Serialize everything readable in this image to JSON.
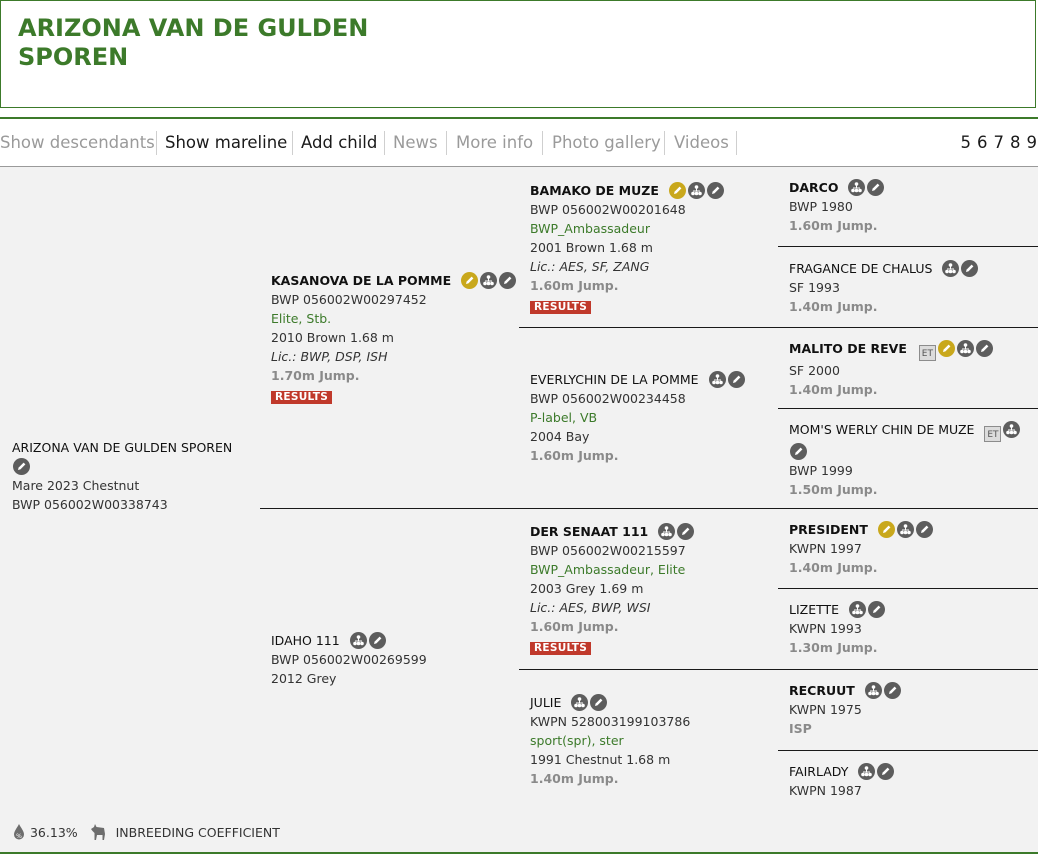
{
  "title": "ARIZONA VAN DE GULDEN SPOREN",
  "nav": {
    "items": [
      "Show descendants",
      "Show mareline",
      "Add child",
      "News",
      "More info",
      "Photo gallery",
      "Videos"
    ],
    "generations": [
      "5",
      "6",
      "7",
      "8",
      "9"
    ]
  },
  "subject": {
    "name": "ARIZONA VAN DE GULDEN SPOREN",
    "desc": "Mare 2023 Chestnut",
    "reg": "BWP 056002W00338743"
  },
  "sire": {
    "name": "KASANOVA DE LA POMME",
    "reg": "BWP 056002W00297452",
    "pred": "Elite, Stb.",
    "desc": "2010 Brown 1.68 m",
    "lic": "Lic.: BWP, DSP, ISH",
    "jump": "1.70m Jump.",
    "results": "RESULTS"
  },
  "dam": {
    "name": "IDAHO 111",
    "reg": "BWP 056002W00269599",
    "desc": "2012 Grey"
  },
  "ss": {
    "name": "BAMAKO DE MUZE",
    "reg": "BWP 056002W00201648",
    "pred": "BWP_Ambassadeur",
    "desc": "2001 Brown 1.68 m",
    "lic": "Lic.: AES, SF, ZANG",
    "jump": "1.60m Jump.",
    "results": "RESULTS"
  },
  "sd": {
    "name": "EVERLYCHIN DE LA POMME",
    "reg": "BWP 056002W00234458",
    "pred": "P-label, VB",
    "desc": "2004 Bay",
    "jump": "1.60m Jump."
  },
  "ds": {
    "name": "DER SENAAT 111",
    "reg": "BWP 056002W00215597",
    "pred": "BWP_Ambassadeur, Elite",
    "desc": "2003 Grey 1.69 m",
    "lic": "Lic.: AES, BWP, WSI",
    "jump": "1.60m Jump.",
    "results": "RESULTS"
  },
  "dd": {
    "name": "JULIE",
    "reg": "KWPN 528003199103786",
    "pred": "sport(spr), ster",
    "desc": "1991 Chestnut 1.68 m",
    "jump": "1.40m Jump."
  },
  "g3": [
    {
      "name": "DARCO",
      "line2": "BWP 1980",
      "line3": "1.60m Jump."
    },
    {
      "name": "FRAGANCE DE CHALUS",
      "line2": "SF 1993",
      "line3": "1.40m Jump."
    },
    {
      "name": "MALITO DE REVE",
      "line2": "SF 2000",
      "line3": "1.40m Jump."
    },
    {
      "name": "MOM'S WERLY CHIN DE MUZE",
      "line2": "BWP 1999",
      "line3": "1.50m Jump."
    },
    {
      "name": "PRESIDENT",
      "line2": "KWPN 1997",
      "line3": "1.40m Jump."
    },
    {
      "name": "LIZETTE",
      "line2": "KWPN 1993",
      "line3": "1.30m Jump."
    },
    {
      "name": "RECRUUT",
      "line2": "KWPN 1975",
      "line3": "ISP"
    },
    {
      "name": "FAIRLADY",
      "line2": "KWPN 1987"
    }
  ],
  "badges": {
    "et": "ET"
  },
  "footer": {
    "inbreeding_percent": "36.13%",
    "inbreeding_label": "INBREEDING COEFFICIENT"
  },
  "colors": {
    "brand_green": "#3c7a2a",
    "results_red": "#c0392b",
    "gold_icon": "#c9a81c",
    "dark_icon": "#5d5d5d"
  },
  "icons": {
    "gold": "approved-stallion-icon",
    "tree": "pedigree-tree-icon",
    "pencil": "edit-pencil-icon"
  }
}
